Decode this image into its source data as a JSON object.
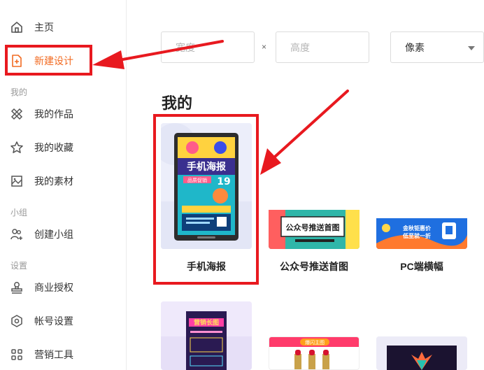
{
  "sidebar": {
    "home": "主页",
    "new_design": "新建设计",
    "section_mine": "我的",
    "my_works": "我的作品",
    "my_favorites": "我的收藏",
    "my_materials": "我的素材",
    "section_group": "小组",
    "create_group": "创建小组",
    "section_settings": "设置",
    "commercial_license": "商业授权",
    "account_settings": "帐号设置",
    "marketing_tools": "营销工具"
  },
  "size_form": {
    "width_placeholder": "宽度",
    "times": "×",
    "height_placeholder": "高度",
    "unit": "像素"
  },
  "main": {
    "section_title": "我的",
    "templates": [
      {
        "label": "手机海报"
      },
      {
        "label": "公众号推送首图"
      },
      {
        "label": "PC端横幅"
      }
    ]
  },
  "thumbs": {
    "poster_title": "手机海报",
    "poster_sub": "品质促销",
    "poster_price": "19",
    "wechat_title": "公众号推送首图",
    "banner_text": "金秋钜惠价",
    "banner_text2": "低至就一折",
    "row2_sub": "营销长图",
    "row2_pink": "爆闪主图"
  },
  "colors": {
    "accent": "#f26b22",
    "highlight": "#e8191f"
  }
}
